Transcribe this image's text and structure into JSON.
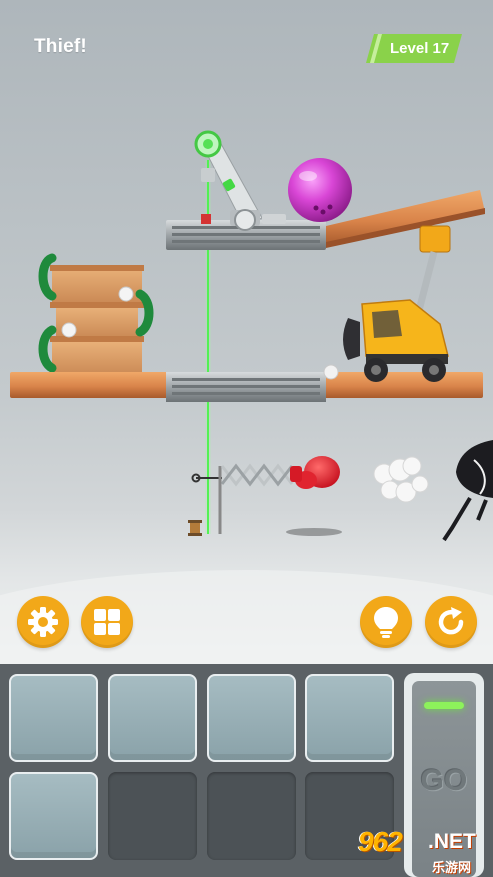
{
  "header": {
    "title": "Thief!",
    "level_label": "Level 17"
  },
  "controls": {
    "settings_icon": "gear-icon",
    "menu_icon": "grid-icon",
    "hint_icon": "lightbulb-icon",
    "restart_icon": "restart-icon"
  },
  "tray": {
    "slots": [
      {
        "state": "filled"
      },
      {
        "state": "filled"
      },
      {
        "state": "filled"
      },
      {
        "state": "filled"
      },
      {
        "state": "filled"
      },
      {
        "state": "empty"
      },
      {
        "state": "empty"
      },
      {
        "state": "empty"
      }
    ],
    "go_label": "GO"
  },
  "watermark": {
    "brand": "962",
    "suffix": ".NET",
    "subtitle": "乐游网"
  },
  "colors": {
    "accent": "#f2a819",
    "level_badge": "#8ad24a",
    "laser": "#3cf23c",
    "go_light": "#8df25b",
    "tray_bg": "#5b6165"
  }
}
